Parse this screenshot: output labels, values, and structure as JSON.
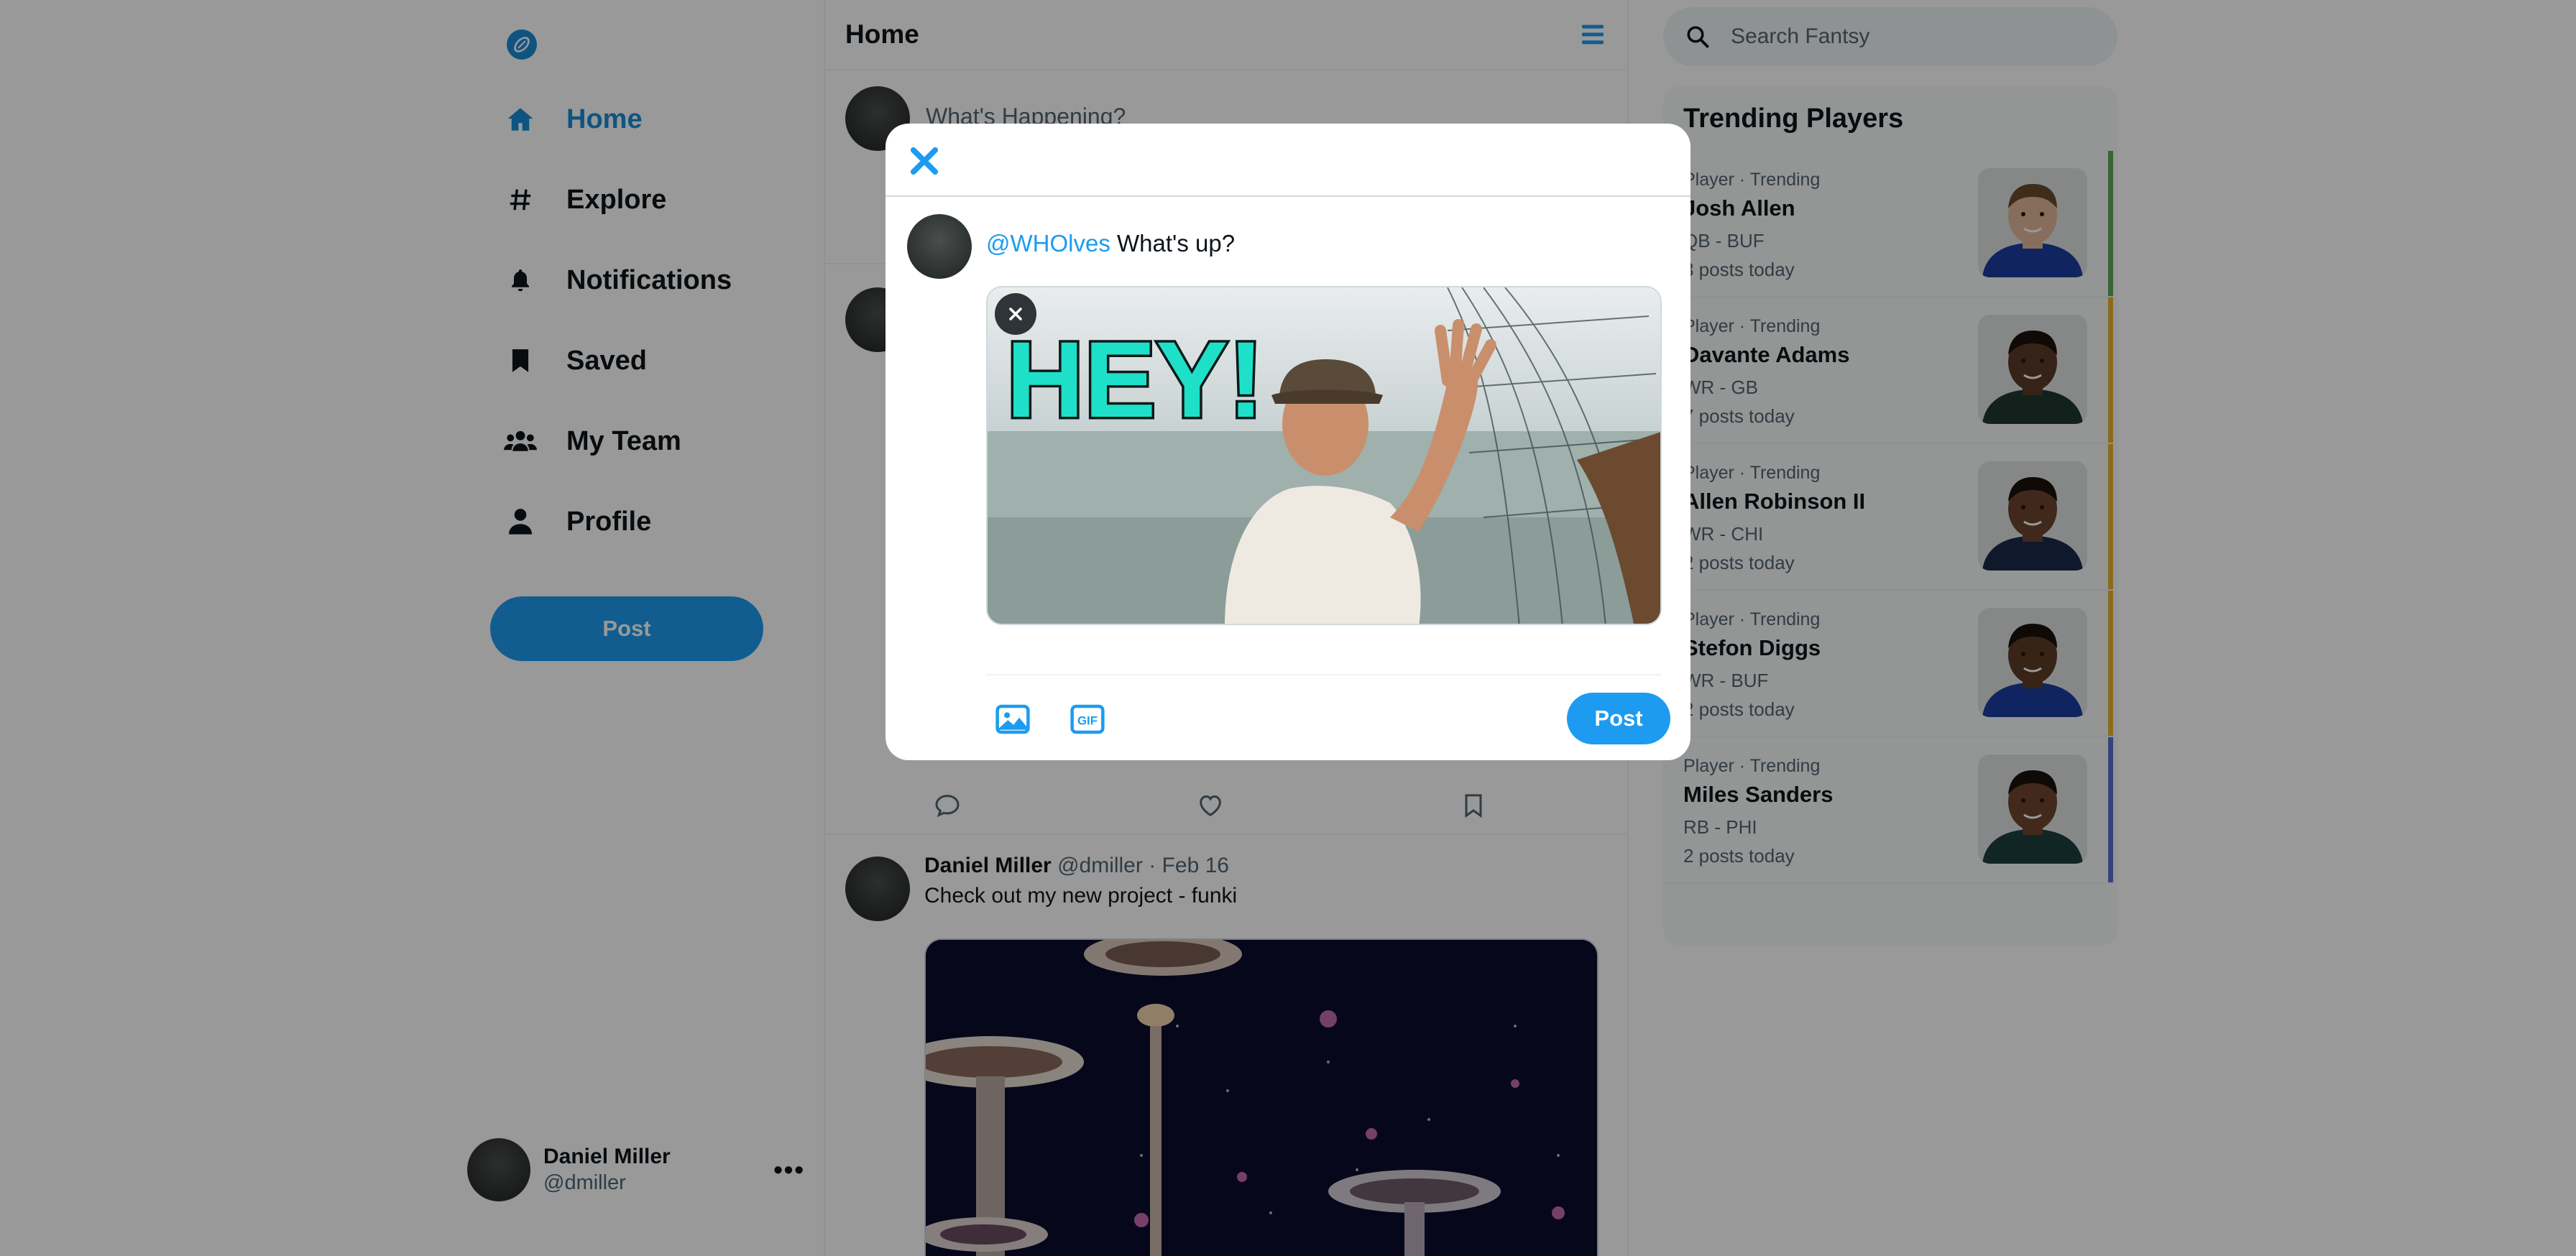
{
  "sidebar": {
    "logo_icon": "football-icon",
    "nav": [
      {
        "label": "Home",
        "icon": "home-icon",
        "active": true
      },
      {
        "label": "Explore",
        "icon": "hashtag-icon"
      },
      {
        "label": "Notifications",
        "icon": "bell-icon"
      },
      {
        "label": "Saved",
        "icon": "bookmark-icon"
      },
      {
        "label": "My Team",
        "icon": "users-icon"
      },
      {
        "label": "Profile",
        "icon": "user-icon"
      }
    ],
    "post_label": "Post",
    "account": {
      "name": "Daniel Miller",
      "handle": "@dmiller",
      "more": "•••"
    }
  },
  "feed": {
    "title": "Home",
    "compose_placeholder": "What's Happening?",
    "post": {
      "author": "Daniel Miller",
      "handle": "@dmiller",
      "date": "Feb 16",
      "text": "Check out my new project - funki"
    }
  },
  "search": {
    "placeholder": "Search Fantsy"
  },
  "trending": {
    "title": "Trending Players",
    "players": [
      {
        "meta": "Player · Trending",
        "name": "Josh Allen",
        "pos": "QB - BUF",
        "count": "3 posts today",
        "bar": "#5fa85a",
        "jersey": "#1b3d9e",
        "skin": "#e2b89a",
        "hair": "#6b4a2c"
      },
      {
        "meta": "Player · Trending",
        "name": "Davante Adams",
        "pos": "WR - GB",
        "count": "7 posts today",
        "bar": "#e8b22e",
        "jersey": "#203731",
        "skin": "#5a3a26",
        "hair": "#1c120b"
      },
      {
        "meta": "Player · Trending",
        "name": "Allen Robinson II",
        "pos": "WR - CHI",
        "count": "2 posts today",
        "bar": "#e8b22e",
        "jersey": "#1c2a48",
        "skin": "#6b4330",
        "hair": "#1c120b"
      },
      {
        "meta": "Player · Trending",
        "name": "Stefon Diggs",
        "pos": "WR - BUF",
        "count": "2 posts today",
        "bar": "#e8b22e",
        "jersey": "#1b3d9e",
        "skin": "#5e3b27",
        "hair": "#1c120b"
      },
      {
        "meta": "Player · Trending",
        "name": "Miles Sanders",
        "pos": "RB - PHI",
        "count": "2 posts today",
        "bar": "#5b6fd1",
        "jersey": "#1d3f3f",
        "skin": "#6e4530",
        "hair": "#1c120b"
      }
    ]
  },
  "modal": {
    "mention": "@WHOlves",
    "text": " What's up?",
    "gif_caption": "HEY!",
    "post_label": "Post",
    "gif_button": "GIF"
  },
  "colors": {
    "accent": "#1d9bf0",
    "accent_dark": "#1a8cd8"
  }
}
